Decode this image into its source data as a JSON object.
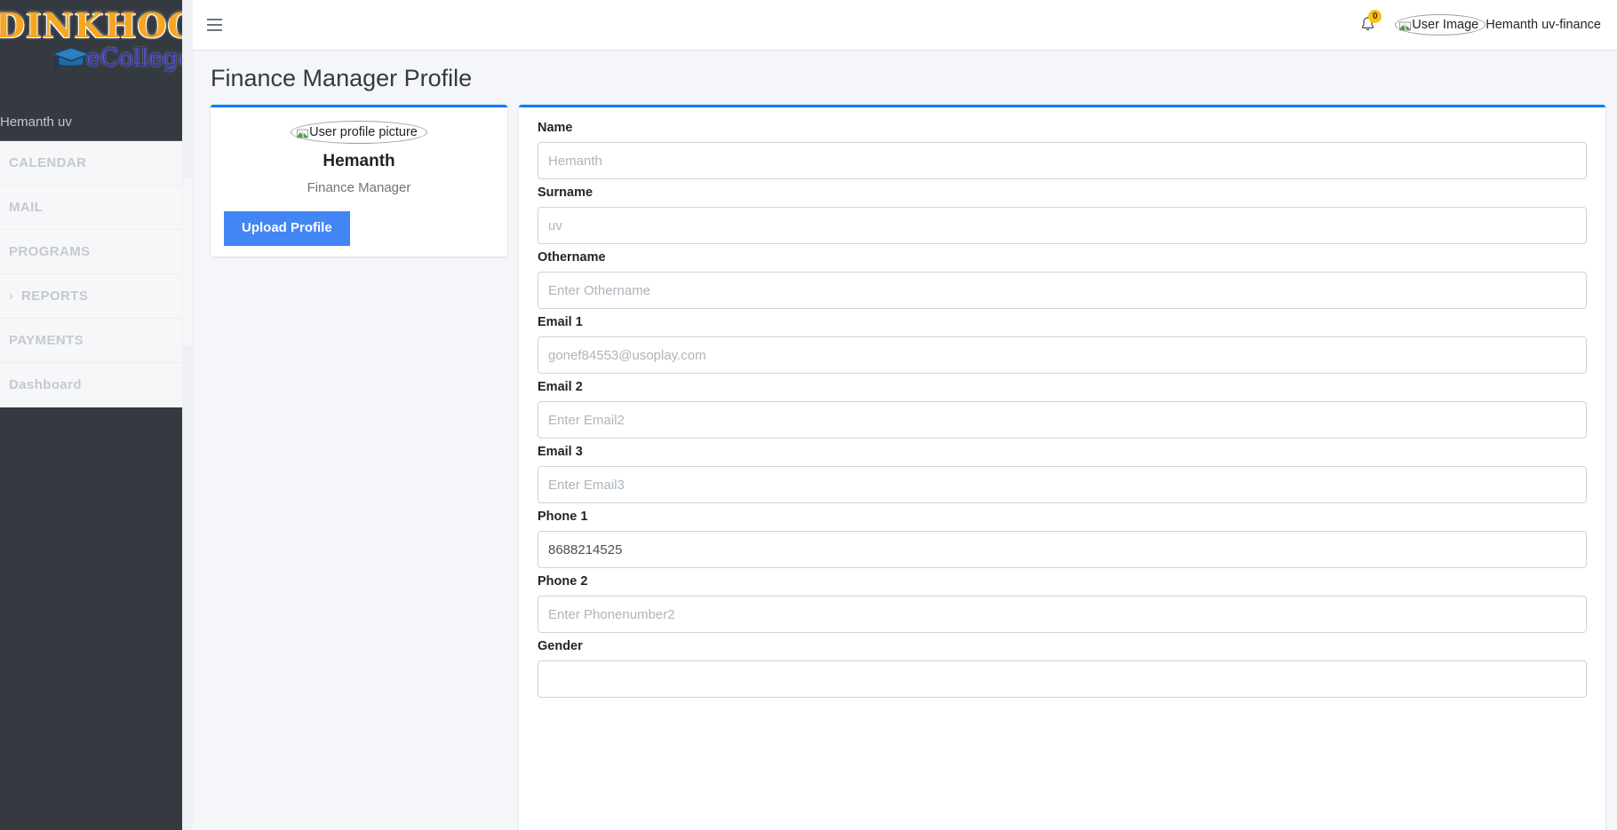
{
  "brand": {
    "logo_main": "DINKHOO!",
    "logo_sub": "eCollege",
    "cap_icon": "graduation-cap-icon"
  },
  "sidebar": {
    "user_label": "Hemanth uv",
    "items": [
      {
        "label": "CALENDAR",
        "has_chevron": false
      },
      {
        "label": "MAIL",
        "has_chevron": false
      },
      {
        "label": "PROGRAMS",
        "has_chevron": false
      },
      {
        "label": "REPORTS",
        "has_chevron": true,
        "chevron": "›"
      },
      {
        "label": "PAYMENTS",
        "has_chevron": false
      },
      {
        "label": "Dashboard",
        "has_chevron": false
      }
    ]
  },
  "navbar": {
    "menu_icon": "hamburger-icon",
    "bell_icon": "bell-icon",
    "notification_count": "0",
    "user_image_alt": "User Image",
    "user_name": "Hemanth uv-finance"
  },
  "page": {
    "title": "Finance Manager Profile"
  },
  "profile_card": {
    "image_alt": "User profile picture",
    "name": "Hemanth",
    "role": "Finance Manager",
    "upload_button": "Upload Profile"
  },
  "form": {
    "fields": [
      {
        "label": "Name",
        "placeholder": "Hemanth",
        "value": ""
      },
      {
        "label": "Surname",
        "placeholder": "uv",
        "value": ""
      },
      {
        "label": "Othername",
        "placeholder": "Enter Othername",
        "value": ""
      },
      {
        "label": "Email 1",
        "placeholder": "gonef84553@usoplay.com",
        "value": ""
      },
      {
        "label": "Email 2",
        "placeholder": "Enter Email2",
        "value": ""
      },
      {
        "label": "Email 3",
        "placeholder": "Enter Email3",
        "value": ""
      },
      {
        "label": "Phone 1",
        "placeholder": "",
        "value": "8688214525"
      },
      {
        "label": "Phone 2",
        "placeholder": "Enter Phonenumber2",
        "value": ""
      },
      {
        "label": "Gender",
        "placeholder": "",
        "value": ""
      }
    ]
  },
  "colors": {
    "sidebar_bg": "#343a40",
    "accent_blue": "#007bff",
    "button_blue": "#4285f4",
    "badge_yellow": "#ffc107",
    "content_bg": "#f4f6f9"
  }
}
